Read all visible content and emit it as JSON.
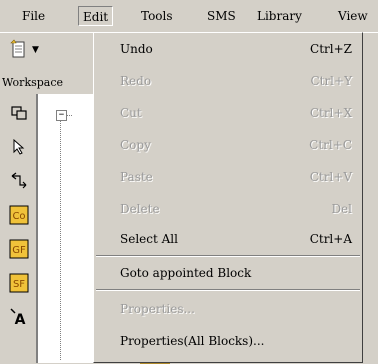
{
  "menubar": {
    "items": [
      {
        "label": "File"
      },
      {
        "label": "Edit"
      },
      {
        "label": "Tools"
      },
      {
        "label": "SMS"
      },
      {
        "label": "Library"
      },
      {
        "label": "View"
      }
    ],
    "active": "Edit"
  },
  "toolbar": {
    "new_icon": "new-document-icon",
    "dropdown_icon": "dropdown-arrow-icon"
  },
  "workspace": {
    "label": "Workspace",
    "tree_expand": "−"
  },
  "sidebar": {
    "tools": [
      {
        "icon": "layout-icon"
      },
      {
        "icon": "pointer-arrow-icon"
      },
      {
        "icon": "connector-icon"
      },
      {
        "icon": "co-block-icon",
        "text": "Co"
      },
      {
        "icon": "gf-block-icon",
        "text": "GF"
      },
      {
        "icon": "sf-block-icon",
        "text": "SF"
      },
      {
        "icon": "text-tool-icon",
        "text": "A"
      }
    ]
  },
  "edit_menu": {
    "items": [
      {
        "label": "Undo",
        "shortcut": "Ctrl+Z",
        "enabled": true
      },
      {
        "label": "Redo",
        "shortcut": "Ctrl+Y",
        "enabled": false
      },
      {
        "label": "Cut",
        "shortcut": "Ctrl+X",
        "enabled": false
      },
      {
        "label": "Copy",
        "shortcut": "Ctrl+C",
        "enabled": false
      },
      {
        "label": "Paste",
        "shortcut": "Ctrl+V",
        "enabled": false
      },
      {
        "label": "Delete",
        "shortcut": "Del",
        "enabled": false
      },
      {
        "label": "Select All",
        "shortcut": "Ctrl+A",
        "enabled": true
      },
      {
        "label": "Goto appointed Block",
        "shortcut": "",
        "enabled": true
      },
      {
        "label": "Properties...",
        "shortcut": "",
        "enabled": false
      },
      {
        "label": "Properties(All Blocks)...",
        "shortcut": "",
        "enabled": true
      }
    ]
  },
  "colors": {
    "face": "#d4d0c8",
    "disabled_text": "#9a9a9a",
    "shadow": "#808080",
    "block_fill": "#f0c23a",
    "block_text": "#8a4a00"
  }
}
